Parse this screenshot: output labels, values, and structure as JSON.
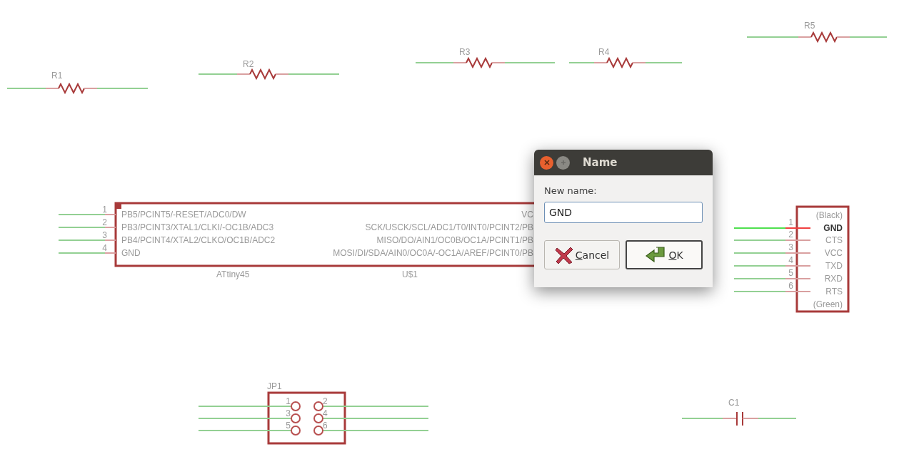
{
  "schematic": {
    "resistors": [
      {
        "label": "R1"
      },
      {
        "label": "R2"
      },
      {
        "label": "R3"
      },
      {
        "label": "R4"
      },
      {
        "label": "R5"
      }
    ],
    "chip": {
      "name": "ATtiny45",
      "reference": "U$1",
      "left_pins": [
        {
          "number": "1",
          "name": "PB5/PCINT5/-RESET/ADC0/DW"
        },
        {
          "number": "2",
          "name": "PB3/PCINT3/XTAL1/CLKI/-OC1B/ADC3"
        },
        {
          "number": "3",
          "name": "PB4/PCINT4/XTAL2/CLKO/OC1B/ADC2"
        },
        {
          "number": "4",
          "name": "GND"
        }
      ],
      "right_pins": [
        {
          "name": "VC"
        },
        {
          "name": "SCK/USCK/SCL/ADC1/T0/INT0/PCINT2/PB"
        },
        {
          "name": "MISO/DO/AIN1/OC0B/OC1A/PCINT1/PB"
        },
        {
          "name": "MOSI/DI/SDA/AIN0/OC0A/-OC1A/AREF/PCINT0/PB"
        }
      ]
    },
    "header": {
      "top_label": "(Black)",
      "bottom_label": "(Green)",
      "pins": [
        {
          "number": "1",
          "name": "GND",
          "highlighted": true
        },
        {
          "number": "2",
          "name": "CTS",
          "highlighted": false
        },
        {
          "number": "3",
          "name": "VCC",
          "highlighted": false
        },
        {
          "number": "4",
          "name": "TXD",
          "highlighted": false
        },
        {
          "number": "5",
          "name": "RXD",
          "highlighted": false
        },
        {
          "number": "6",
          "name": "RTS",
          "highlighted": false
        }
      ]
    },
    "jumper": {
      "label": "JP1",
      "pins": [
        "1",
        "2",
        "3",
        "4",
        "5",
        "6"
      ]
    },
    "capacitor": {
      "label": "C1"
    }
  },
  "dialog": {
    "title": "Name",
    "field_label": "New name:",
    "value": "GND",
    "buttons": [
      {
        "kind": "cancel",
        "label": "Cancel",
        "default": false
      },
      {
        "kind": "ok",
        "label": "OK",
        "default": true
      }
    ]
  }
}
